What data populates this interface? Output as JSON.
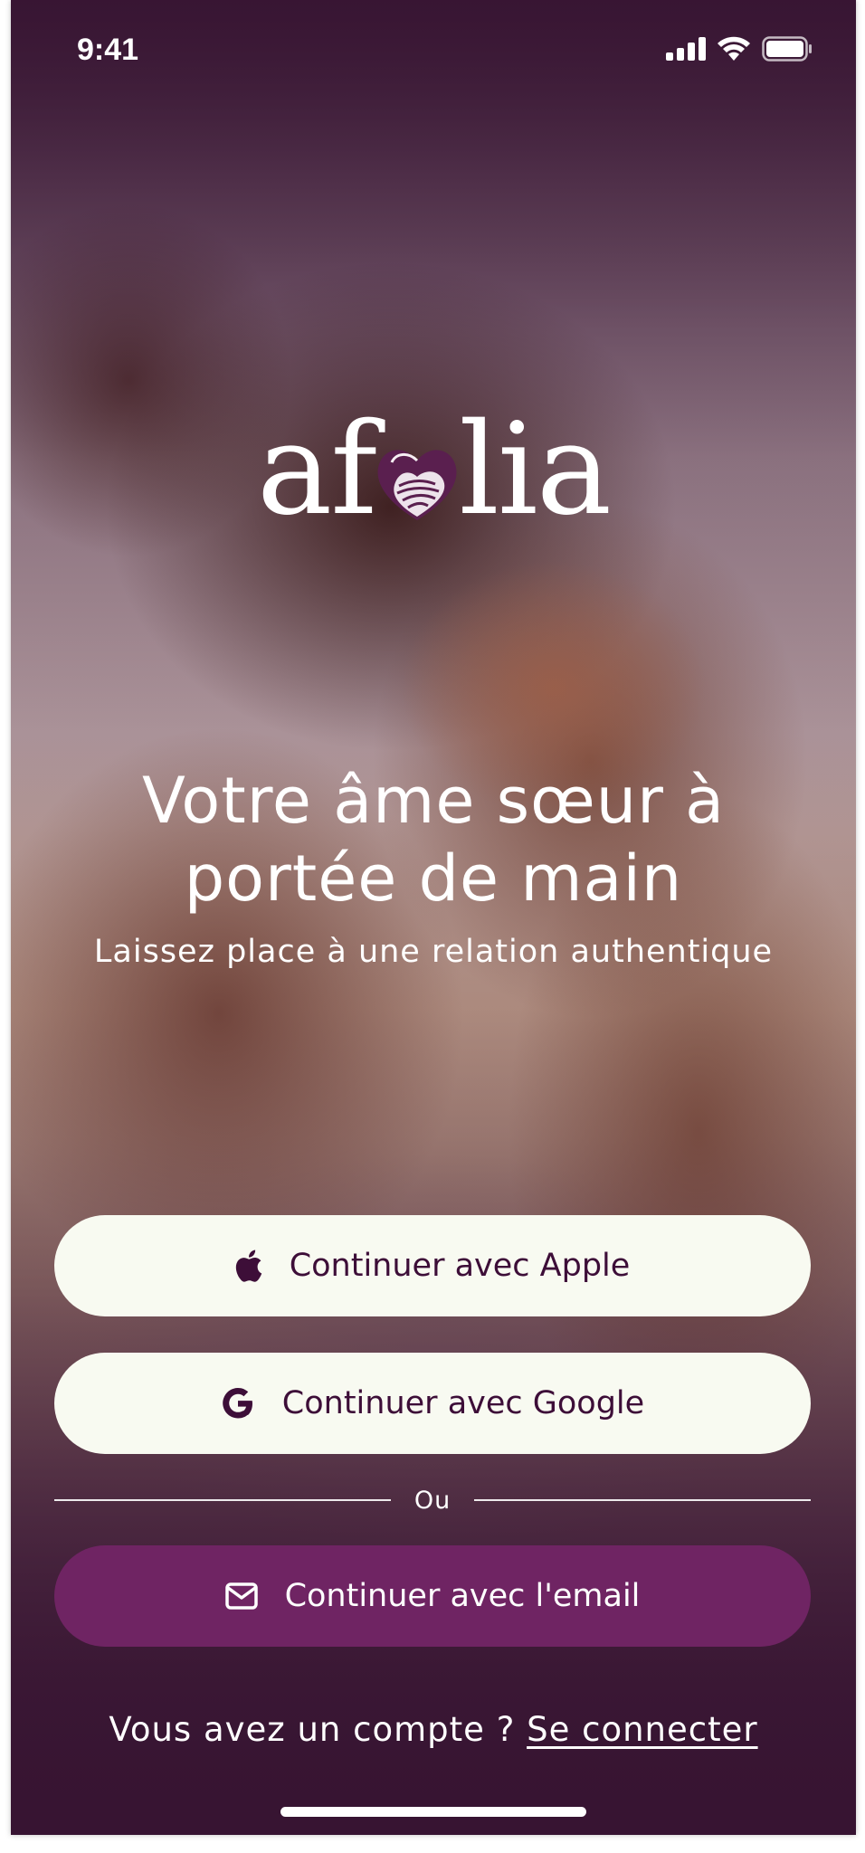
{
  "status_bar": {
    "time": "9:41",
    "icons": [
      "cellular-signal-icon",
      "wifi-icon",
      "battery-icon"
    ]
  },
  "brand": {
    "logo_text_left": "af",
    "logo_text_right": "lia",
    "logo_mark": "heart-icon",
    "accent_color": "#6f2463"
  },
  "hero": {
    "headline": "Votre âme sœur à\nportée de main",
    "subheadline": "Laissez place à une relation authentique"
  },
  "auth": {
    "apple_label": "Continuer avec Apple",
    "apple_icon": "apple-icon",
    "google_label": "Continuer avec Google",
    "google_icon": "google-icon",
    "divider_label": "Ou",
    "email_label": "Continuer avec l'email",
    "email_icon": "mail-icon"
  },
  "footer": {
    "account_prompt": "Vous avez un compte ?",
    "signin_link": "Se connecter"
  }
}
